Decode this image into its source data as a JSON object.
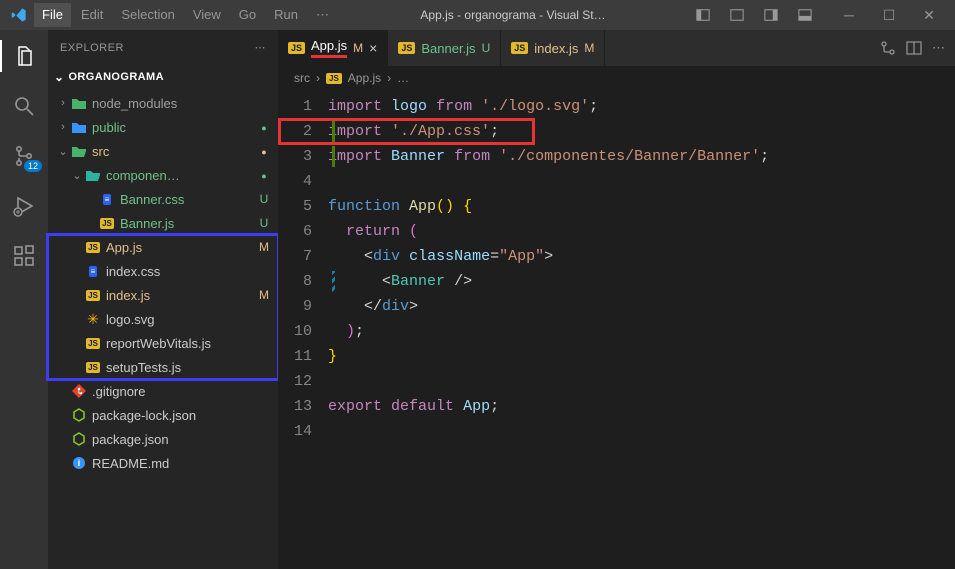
{
  "menubar": [
    "File",
    "Edit",
    "Selection",
    "View",
    "Go",
    "Run",
    "⋯"
  ],
  "window_title": "App.js - organograma - Visual St…",
  "activity": {
    "scm_badge": "12"
  },
  "sidebar": {
    "title": "EXPLORER",
    "section": "ORGANOGRAMA",
    "rows": [
      {
        "indent": 0,
        "twisty": "›",
        "iconType": "folder-mod",
        "label": "node_modules",
        "labelClass": "fg-gray"
      },
      {
        "indent": 0,
        "twisty": "›",
        "iconType": "folder-blue",
        "label": "public",
        "labelClass": "fg-untracked",
        "status": "●",
        "statusClass": "untracked dot"
      },
      {
        "indent": 0,
        "twisty": "⌄",
        "iconType": "folder-green",
        "label": "src",
        "labelClass": "fg-mod",
        "status": "●",
        "statusClass": "mod dot"
      },
      {
        "indent": 1,
        "twisty": "⌄",
        "iconType": "folder-teal",
        "label": "componen…",
        "labelClass": "fg-untracked",
        "status": "●",
        "statusClass": "untracked dot"
      },
      {
        "indent": 2,
        "twisty": "",
        "iconType": "css",
        "label": "Banner.css",
        "labelClass": "fg-untracked",
        "status": "U",
        "statusClass": "untracked"
      },
      {
        "indent": 2,
        "twisty": "",
        "iconType": "js",
        "label": "Banner.js",
        "labelClass": "fg-untracked",
        "status": "U",
        "statusClass": "untracked"
      },
      {
        "indent": 1,
        "twisty": "",
        "iconType": "js",
        "label": "App.js",
        "labelClass": "fg-mod",
        "status": "M",
        "statusClass": "mod",
        "annotStart": "blue"
      },
      {
        "indent": 1,
        "twisty": "",
        "iconType": "css",
        "label": "index.css",
        "labelClass": ""
      },
      {
        "indent": 1,
        "twisty": "",
        "iconType": "js",
        "label": "index.js",
        "labelClass": "fg-mod",
        "status": "M",
        "statusClass": "mod"
      },
      {
        "indent": 1,
        "twisty": "",
        "iconType": "svg",
        "label": "logo.svg",
        "labelClass": ""
      },
      {
        "indent": 1,
        "twisty": "",
        "iconType": "js",
        "label": "reportWebVitals.js",
        "labelClass": ""
      },
      {
        "indent": 1,
        "twisty": "",
        "iconType": "js",
        "label": "setupTests.js",
        "labelClass": "",
        "annotEnd": "blue"
      },
      {
        "indent": 0,
        "twisty": "",
        "iconType": "git",
        "label": ".gitignore",
        "labelClass": ""
      },
      {
        "indent": 0,
        "twisty": "",
        "iconType": "node",
        "label": "package-lock.json",
        "labelClass": ""
      },
      {
        "indent": 0,
        "twisty": "",
        "iconType": "node",
        "label": "package.json",
        "labelClass": ""
      },
      {
        "indent": 0,
        "twisty": "",
        "iconType": "info",
        "label": "README.md",
        "labelClass": ""
      }
    ]
  },
  "tabs": [
    {
      "icon": "js",
      "label": "App.js",
      "status": "M",
      "statusClass": "mod",
      "active": true,
      "closable": true,
      "redUnderline": true
    },
    {
      "icon": "js",
      "label": "Banner.js",
      "status": "U",
      "statusClass": "untracked",
      "active": false
    },
    {
      "icon": "js",
      "label": "index.js",
      "status": "M",
      "statusClass": "mod",
      "active": false
    }
  ],
  "breadcrumbs": [
    "src",
    "App.js",
    "…"
  ],
  "code": {
    "lines": [
      {
        "n": 1,
        "gutter": "",
        "html": "<span class='kw'>import</span> <span class='var'>logo</span> <span class='kw'>from</span> <span class='str'>'./logo.svg'</span><span class='punct'>;</span>"
      },
      {
        "n": 2,
        "gutter": "green",
        "redbox": true,
        "html": "<span class='kw'>import</span> <span class='str'>'./App.css'</span><span class='punct'>;</span>"
      },
      {
        "n": 3,
        "gutter": "green",
        "html": "<span class='kw'>import</span> <span class='var'>Banner</span> <span class='kw'>from</span> <span class='str'>'./componentes/Banner/Banner'</span><span class='punct'>;</span>"
      },
      {
        "n": 4,
        "gutter": "",
        "html": ""
      },
      {
        "n": 5,
        "gutter": "",
        "html": "<span class='tag'>function</span> <span class='fn'>App</span><span class='brace1'>()</span> <span class='brace1'>{</span>"
      },
      {
        "n": 6,
        "gutter": "",
        "html": "  <span class='ctrl'>return</span> <span class='brace2'>(</span>"
      },
      {
        "n": 7,
        "gutter": "",
        "html": "    <span class='punct'>&lt;</span><span class='tag'>div</span> <span class='attr'>className</span><span class='punct'>=</span><span class='str'>\"App\"</span><span class='punct'>&gt;</span>"
      },
      {
        "n": 8,
        "gutter": "hatch",
        "html": "      <span class='punct'>&lt;</span><span class='type'>Banner</span> <span class='punct'>/&gt;</span>"
      },
      {
        "n": 9,
        "gutter": "",
        "html": "    <span class='punct'>&lt;/</span><span class='tag'>div</span><span class='punct'>&gt;</span>"
      },
      {
        "n": 10,
        "gutter": "",
        "html": "  <span class='brace2'>)</span><span class='punct'>;</span>"
      },
      {
        "n": 11,
        "gutter": "",
        "html": "<span class='brace1'>}</span>"
      },
      {
        "n": 12,
        "gutter": "",
        "html": ""
      },
      {
        "n": 13,
        "gutter": "",
        "html": "<span class='ctrl'>export</span> <span class='ctrl'>default</span> <span class='var'>App</span><span class='punct'>;</span>"
      },
      {
        "n": 14,
        "gutter": "",
        "html": ""
      }
    ]
  }
}
